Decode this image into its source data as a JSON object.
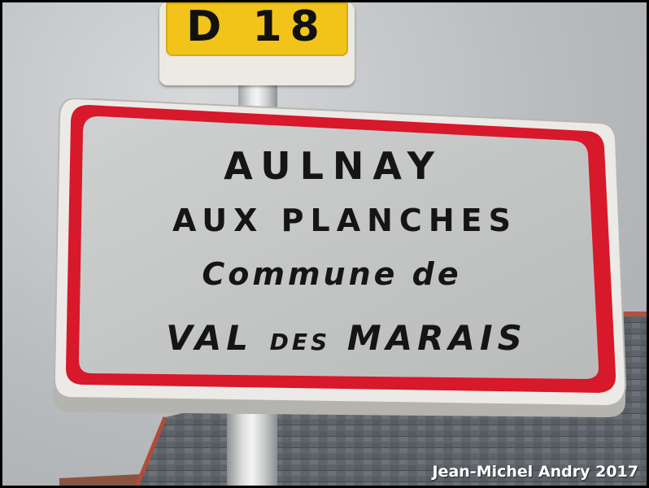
{
  "route_plate": {
    "text": "D 18",
    "color": "#f2c318"
  },
  "sign": {
    "line1": "AULNAY",
    "line2": "AUX PLANCHES",
    "line3": "Commune de",
    "line4_a": "VAL",
    "line4_b": "DES",
    "line4_c": "MARAIS",
    "border_color": "#d8182b",
    "background_color": "#c9cbcb"
  },
  "watermark": "Jean-Michel Andry 2017"
}
